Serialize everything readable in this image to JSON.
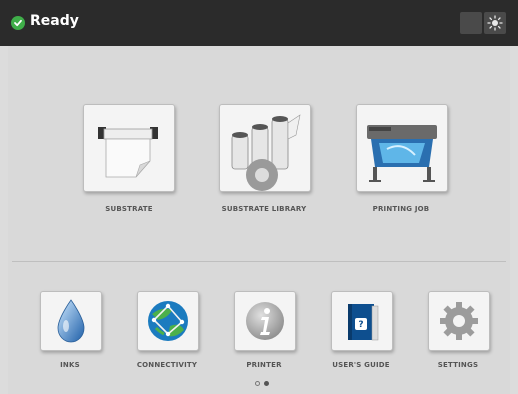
{
  "header": {
    "status": "Ready",
    "icons": [
      "checkmark-icon",
      "brightness-icon"
    ]
  },
  "main_tiles": [
    {
      "label": "SUBSTRATE",
      "icon": "substrate-roll-icon"
    },
    {
      "label": "SUBSTRATE LIBRARY",
      "icon": "substrate-library-icon"
    },
    {
      "label": "PRINTING JOB",
      "icon": "printer-job-icon"
    }
  ],
  "bottom_tiles": [
    {
      "label": "INKS",
      "icon": "ink-drop-icon"
    },
    {
      "label": "CONNECTIVITY",
      "icon": "globe-icon"
    },
    {
      "label": "PRINTER",
      "icon": "info-icon"
    },
    {
      "label": "USER'S GUIDE",
      "icon": "book-icon"
    },
    {
      "label": "SETTINGS",
      "icon": "gear-icon"
    }
  ],
  "pagination": {
    "pages": 2,
    "current": 2
  },
  "colors": {
    "topbar": "#2b2b2b",
    "background": "#d9d9d9",
    "status_ok": "#3fae49",
    "tile": "#f4f4f4"
  }
}
